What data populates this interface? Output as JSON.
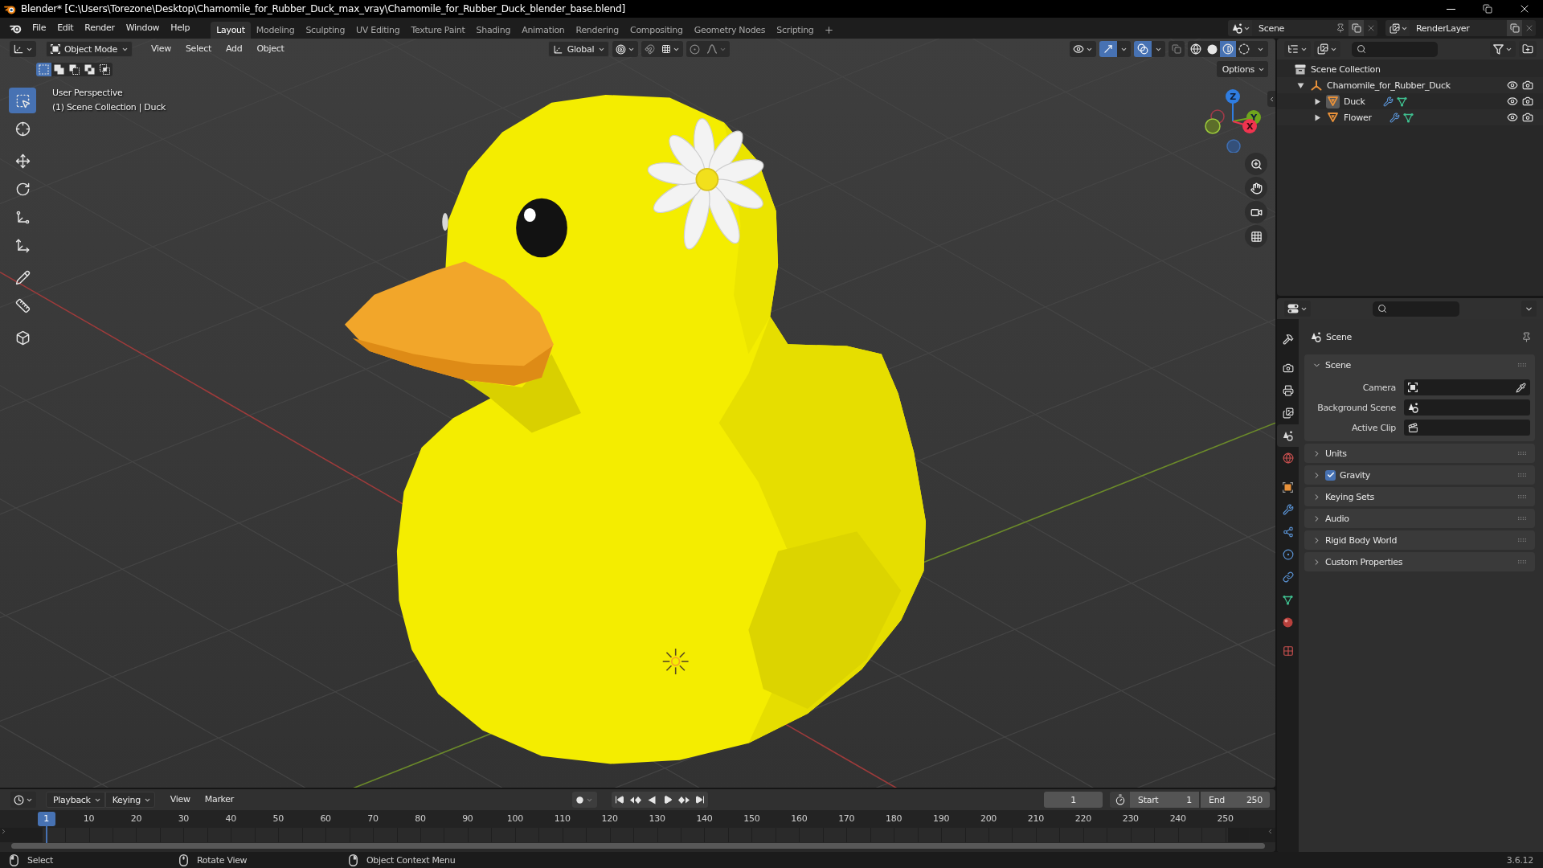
{
  "window": {
    "title": "Blender* [C:\\Users\\Torezone\\Desktop\\Chamomile_for_Rubber_Duck_max_vray\\Chamomile_for_Rubber_Duck_blender_base.blend]"
  },
  "menu": [
    "File",
    "Edit",
    "Render",
    "Window",
    "Help"
  ],
  "workspaces": [
    {
      "label": "Layout",
      "selected": true
    },
    {
      "label": "Modeling",
      "selected": false
    },
    {
      "label": "Sculpting",
      "selected": false
    },
    {
      "label": "UV Editing",
      "selected": false
    },
    {
      "label": "Texture Paint",
      "selected": false
    },
    {
      "label": "Shading",
      "selected": false
    },
    {
      "label": "Animation",
      "selected": false
    },
    {
      "label": "Rendering",
      "selected": false
    },
    {
      "label": "Compositing",
      "selected": false
    },
    {
      "label": "Geometry Nodes",
      "selected": false
    },
    {
      "label": "Scripting",
      "selected": false
    }
  ],
  "scene": {
    "value": "Scene"
  },
  "view_layer": {
    "value": "RenderLayer"
  },
  "viewport": {
    "mode": "Object Mode",
    "menus": [
      "View",
      "Select",
      "Add",
      "Object"
    ],
    "orientation": "Global",
    "snap": false,
    "proportional_editing": false,
    "show_gizmos": true,
    "show_overlays": true,
    "xray": false,
    "shading": [
      {
        "selected": false
      },
      {
        "selected": false
      },
      {
        "selected": true
      },
      {
        "selected": false
      }
    ],
    "select_modes": [
      {
        "selected": true
      },
      {
        "selected": false
      },
      {
        "selected": false
      },
      {
        "selected": false
      },
      {
        "selected": false
      }
    ],
    "options": "Options",
    "info": [
      "User Perspective",
      "(1) Scene Collection | Duck"
    ],
    "tool_groups": [
      {
        "tools": [
          {
            "selected": true
          },
          {
            "selected": false
          }
        ]
      },
      {
        "tools": [
          {
            "selected": false
          },
          {
            "selected": false
          },
          {
            "selected": false
          },
          {
            "selected": false
          }
        ]
      },
      {
        "tools": [
          {
            "selected": false
          },
          {
            "selected": false
          }
        ]
      },
      {
        "tools": [
          {
            "selected": false
          }
        ]
      }
    ],
    "navigation_gizmo": {
      "axes": [
        {
          "label": "Z",
          "color": "#2f7de1"
        },
        {
          "label": "Y",
          "color": "#6fa51d"
        },
        {
          "label": "X",
          "color": "#f0344f"
        }
      ]
    }
  },
  "outliner": {
    "tree": [
      {
        "label": "Scene Collection",
        "kind": "scene_collection",
        "children": [
          {
            "label": "Chamomile_for_Rubber_Duck",
            "kind": "empty",
            "expanded": true,
            "visible": true,
            "renderable": true,
            "children": [
              {
                "label": "Duck",
                "kind": "object",
                "expanded": false,
                "active": true,
                "visible": true,
                "renderable": true
              },
              {
                "label": "Flower",
                "kind": "object",
                "expanded": false,
                "active": false,
                "visible": true,
                "renderable": true
              }
            ]
          }
        ]
      }
    ]
  },
  "properties": {
    "tab_groups": [
      {
        "tabs": [
          {
            "selected": false
          }
        ]
      },
      {
        "tabs": [
          {
            "selected": false
          },
          {
            "selected": false
          },
          {
            "selected": false
          },
          {
            "selected": true
          },
          {
            "selected": false
          }
        ]
      },
      {
        "tabs": [
          {
            "selected": false
          },
          {
            "selected": false
          },
          {
            "selected": false
          },
          {
            "selected": false
          },
          {
            "selected": false
          },
          {
            "selected": false
          },
          {
            "selected": false
          }
        ]
      },
      {
        "tabs": [
          {
            "selected": false
          }
        ]
      }
    ],
    "context": "Scene",
    "panels": [
      {
        "title": "Scene",
        "kind": "plain",
        "expanded": true,
        "fields": [
          {
            "label": "Camera",
            "kind": "camera"
          },
          {
            "label": "Background Scene",
            "kind": "scene"
          },
          {
            "label": "Active Clip",
            "kind": "clip"
          }
        ]
      },
      {
        "title": "Units",
        "kind": "plain",
        "expanded": false
      },
      {
        "title": "Gravity",
        "kind": "toggle",
        "expanded": false,
        "checked": true
      },
      {
        "title": "Keying Sets",
        "kind": "plain",
        "expanded": false
      },
      {
        "title": "Audio",
        "kind": "plain",
        "expanded": false
      },
      {
        "title": "Rigid Body World",
        "kind": "plain",
        "expanded": false
      },
      {
        "title": "Custom Properties",
        "kind": "plain",
        "expanded": false
      }
    ]
  },
  "timeline": {
    "menus": [
      {
        "label": "Playback",
        "kind": "dropdown"
      },
      {
        "label": "Keying",
        "kind": "dropdown"
      },
      {
        "label": "View",
        "kind": "plain"
      },
      {
        "label": "Marker",
        "kind": "plain"
      }
    ],
    "auto_keying": false,
    "current_frame": "1",
    "playhead": "1",
    "ticks": [
      "10",
      "20",
      "30",
      "40",
      "50",
      "60",
      "70",
      "80",
      "90",
      "100",
      "110",
      "120",
      "130",
      "140",
      "150",
      "160",
      "170",
      "180",
      "190",
      "200",
      "210",
      "220",
      "230",
      "240",
      "250"
    ],
    "start": {
      "label": "Start",
      "value": "1"
    },
    "end": {
      "label": "End",
      "value": "250"
    }
  },
  "status_bar": {
    "hints": [
      "Select",
      "Rotate View",
      "Object Context Menu"
    ],
    "version": "3.6.12"
  }
}
